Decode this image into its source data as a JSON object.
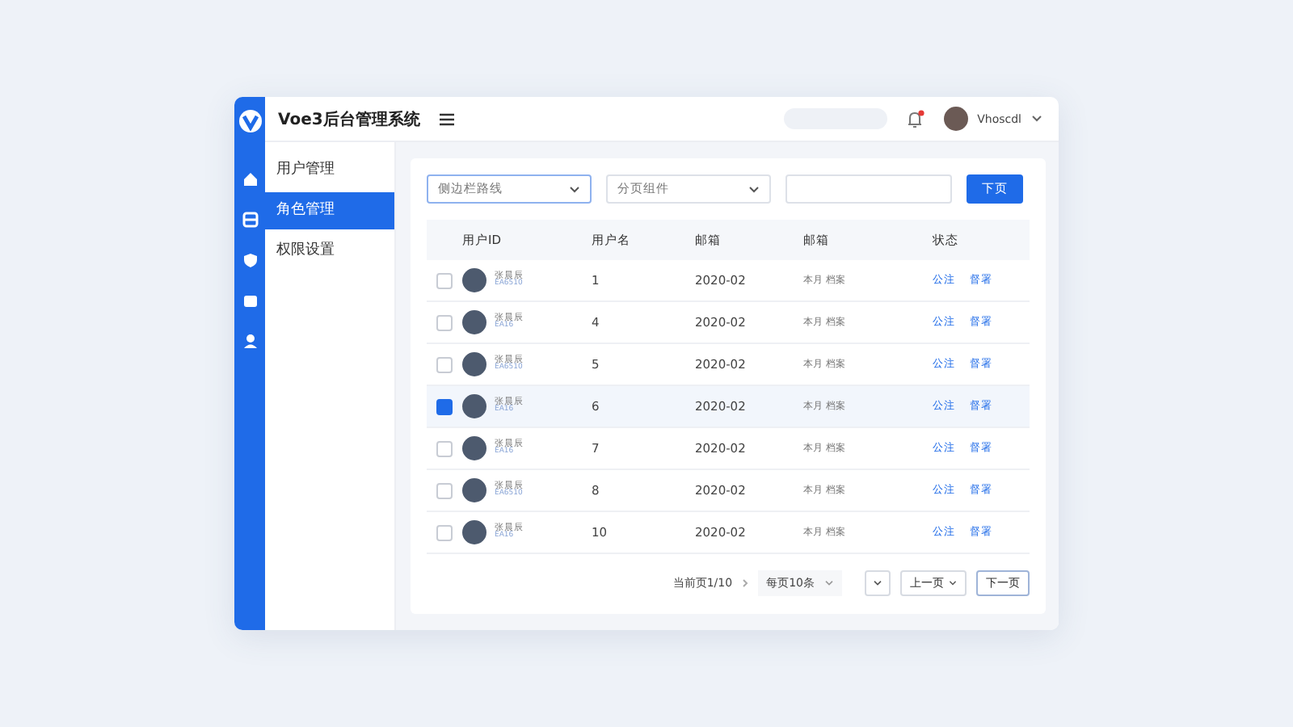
{
  "app": {
    "title": "Voe3后台管理系统"
  },
  "header": {
    "user": "Vhoscdl",
    "notification": true
  },
  "rail": [
    {
      "selected": false
    },
    {
      "selected": false
    },
    {
      "selected": false
    },
    {
      "selected": false
    },
    {
      "selected": false
    }
  ],
  "submenu": [
    {
      "label": "用户管理",
      "selected": false
    },
    {
      "label": "角色管理",
      "selected": true
    },
    {
      "label": "权限设置",
      "selected": false
    }
  ],
  "filters": {
    "select_1": "侧边栏路线",
    "select_2": "分页组件",
    "button": "下页"
  },
  "table": {
    "columns": [
      "用户ID",
      "用户名",
      "邮箱",
      "邮箱",
      "状态"
    ],
    "rows": [
      {
        "selected": false,
        "name": "张晨辰",
        "sub": "EA6510",
        "id": "1",
        "date": "2020-02",
        "email": "本月 档案",
        "actions": [
          "公注",
          "督署"
        ]
      },
      {
        "selected": false,
        "name": "张晨辰",
        "sub": "EA16",
        "id": "4",
        "date": "2020-02",
        "email": "本月 档案",
        "actions": [
          "公注",
          "督署"
        ]
      },
      {
        "selected": false,
        "name": "张晨辰",
        "sub": "EA6510",
        "id": "5",
        "date": "2020-02",
        "email": "本月 档案",
        "actions": [
          "公注",
          "督署"
        ]
      },
      {
        "selected": true,
        "name": "张晨辰",
        "sub": "EA16",
        "id": "6",
        "date": "2020-02",
        "email": "本月 档案",
        "actions": [
          "公注",
          "督署"
        ]
      },
      {
        "selected": false,
        "name": "张晨辰",
        "sub": "EA16",
        "id": "7",
        "date": "2020-02",
        "email": "本月 档案",
        "actions": [
          "公注",
          "督署"
        ]
      },
      {
        "selected": false,
        "name": "张晨辰",
        "sub": "EA6510",
        "id": "8",
        "date": "2020-02",
        "email": "本月 档案",
        "actions": [
          "公注",
          "督署"
        ]
      },
      {
        "selected": false,
        "name": "张晨辰",
        "sub": "EA16",
        "id": "10",
        "date": "2020-02",
        "email": "本月 档案",
        "actions": [
          "公注",
          "督署"
        ]
      }
    ]
  },
  "pagination": {
    "current": "当前页1/10",
    "page_size": "每页10条",
    "prev": "上一页",
    "next": "下一页"
  }
}
